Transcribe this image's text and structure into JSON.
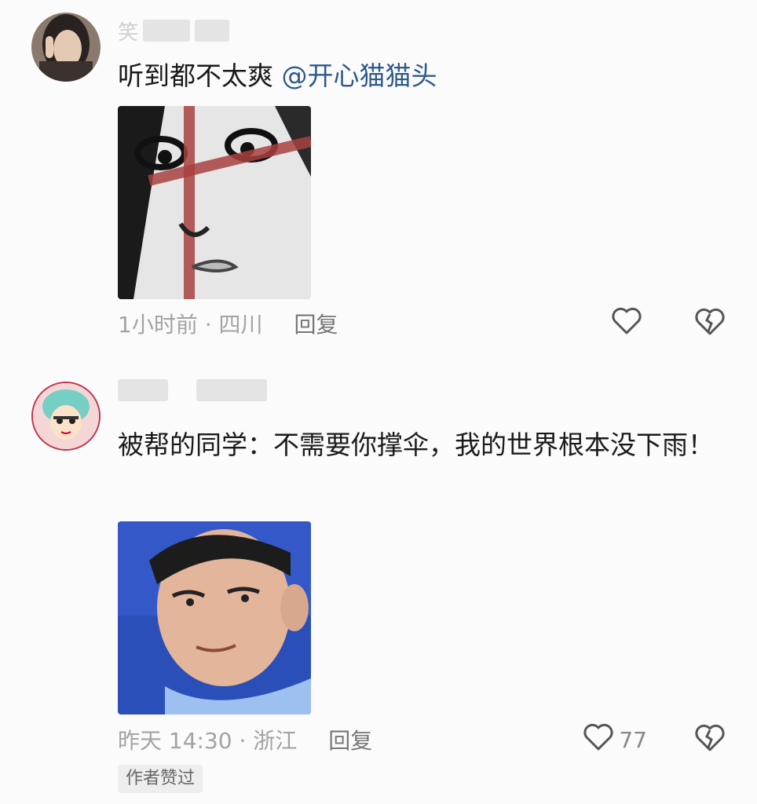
{
  "comments": [
    {
      "username_initial": "笑",
      "text": "听到都不太爽",
      "mention": "@开心猫猫头",
      "time_location": "1小时前 · 四川",
      "reply_label": "回复",
      "like_count": ""
    },
    {
      "username_initial": "",
      "text": "被帮的同学：不需要你撑伞，我的世界根本没下雨！",
      "time_location": "昨天 14:30 · 浙江",
      "reply_label": "回复",
      "like_count": "77",
      "badge": "作者赞过"
    }
  ],
  "icons": {
    "like": "heart-outline-icon",
    "dislike": "broken-heart-icon"
  },
  "colors": {
    "mention": "#2f5a8c",
    "meta": "#a3a3a3"
  }
}
